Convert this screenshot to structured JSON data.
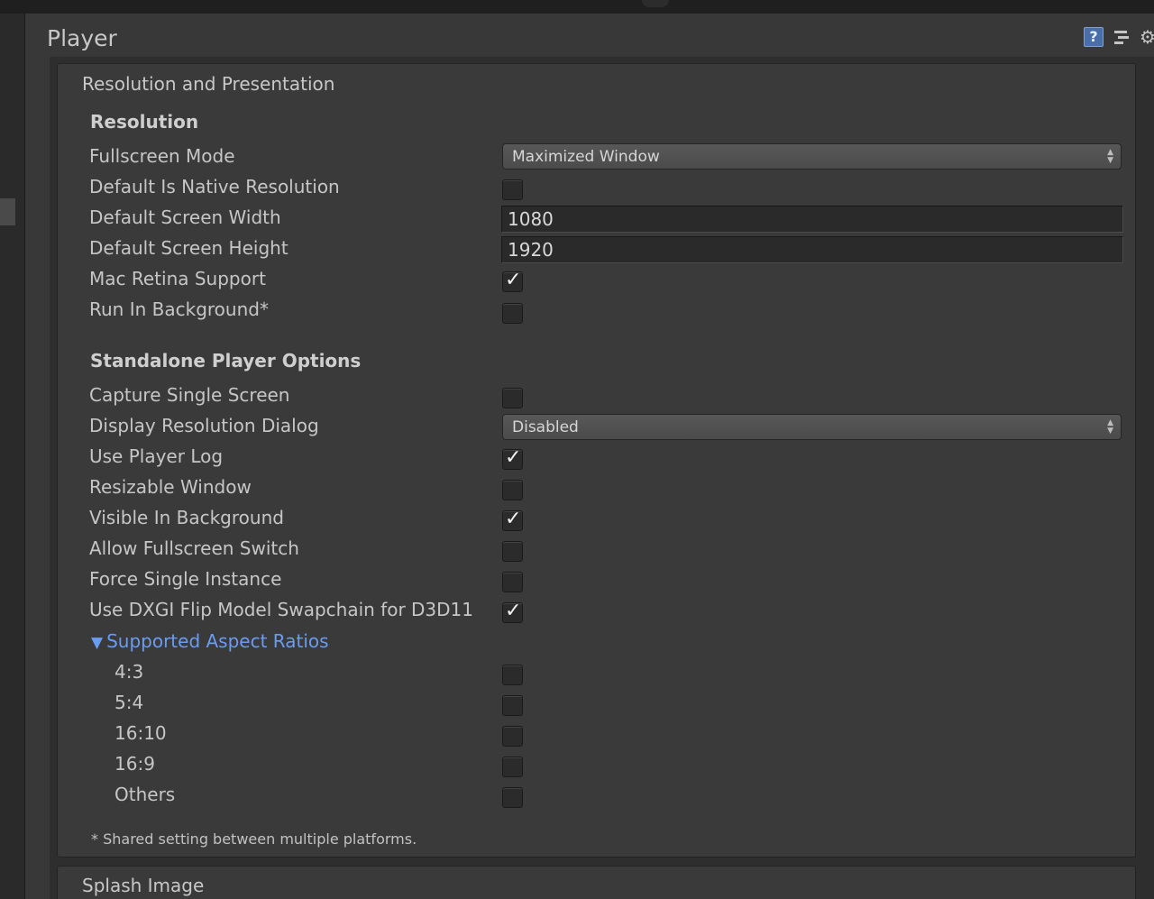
{
  "window": {
    "title": "Player"
  },
  "header": {
    "help_icon_glyph": "?"
  },
  "resolution_section": {
    "title": "Resolution and Presentation",
    "resolution_group": {
      "title": "Resolution",
      "fullscreen_mode": {
        "label": "Fullscreen Mode",
        "value": "Maximized Window"
      },
      "default_is_native": {
        "label": "Default Is Native Resolution",
        "checked": false
      },
      "default_width": {
        "label": "Default Screen Width",
        "value": "1080"
      },
      "default_height": {
        "label": "Default Screen Height",
        "value": "1920"
      },
      "mac_retina": {
        "label": "Mac Retina Support",
        "checked": true
      },
      "run_in_background": {
        "label": "Run In Background*",
        "checked": false
      }
    },
    "standalone_group": {
      "title": "Standalone Player Options",
      "capture_single_screen": {
        "label": "Capture Single Screen",
        "checked": false
      },
      "display_resolution_dialog": {
        "label": "Display Resolution Dialog",
        "value": "Disabled"
      },
      "use_player_log": {
        "label": "Use Player Log",
        "checked": true
      },
      "resizable_window": {
        "label": "Resizable Window",
        "checked": false
      },
      "visible_in_background": {
        "label": "Visible In Background",
        "checked": true
      },
      "allow_fullscreen_switch": {
        "label": "Allow Fullscreen Switch",
        "checked": false
      },
      "force_single_instance": {
        "label": "Force Single Instance",
        "checked": false
      },
      "use_dxgi_flip": {
        "label": "Use DXGI Flip Model Swapchain for D3D11",
        "checked": true
      }
    },
    "aspect_ratios": {
      "label": "Supported Aspect Ratios",
      "expanded": true,
      "items": [
        {
          "label": "4:3",
          "checked": false
        },
        {
          "label": "5:4",
          "checked": false
        },
        {
          "label": "16:10",
          "checked": false
        },
        {
          "label": "16:9",
          "checked": false
        },
        {
          "label": "Others",
          "checked": false
        }
      ]
    },
    "footnote": "* Shared setting between multiple platforms."
  },
  "splash_section": {
    "title": "Splash Image"
  },
  "colors": {
    "background": "#383838",
    "link": "#6a9cf2",
    "help_icon": "#4a6fa8"
  }
}
